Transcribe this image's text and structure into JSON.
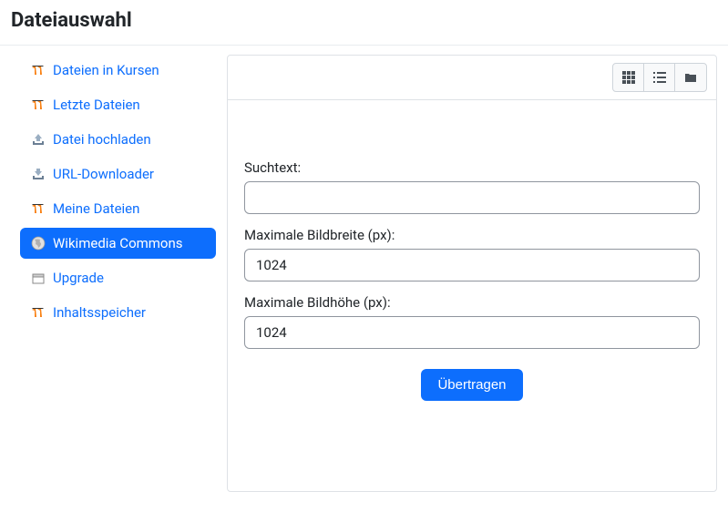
{
  "header": {
    "title": "Dateiauswahl"
  },
  "sidebar": {
    "items": [
      {
        "label": "Dateien in Kursen",
        "icon": "moodle",
        "active": false
      },
      {
        "label": "Letzte Dateien",
        "icon": "moodle",
        "active": false
      },
      {
        "label": "Datei hochladen",
        "icon": "upload",
        "active": false
      },
      {
        "label": "URL-Downloader",
        "icon": "download",
        "active": false
      },
      {
        "label": "Meine Dateien",
        "icon": "moodle",
        "active": false
      },
      {
        "label": "Wikimedia Commons",
        "icon": "globe",
        "active": true
      },
      {
        "label": "Upgrade",
        "icon": "box",
        "active": false
      },
      {
        "label": "Inhaltsspeicher",
        "icon": "moodle",
        "active": false
      }
    ]
  },
  "toolbar": {
    "views": {
      "grid": "grid-view",
      "list": "list-view",
      "tree": "tree-view"
    }
  },
  "form": {
    "search_label": "Suchtext:",
    "search_value": "",
    "width_label": "Maximale Bildbreite (px):",
    "width_value": "1024",
    "height_label": "Maximale Bildhöhe (px):",
    "height_value": "1024",
    "submit_label": "Übertragen"
  }
}
